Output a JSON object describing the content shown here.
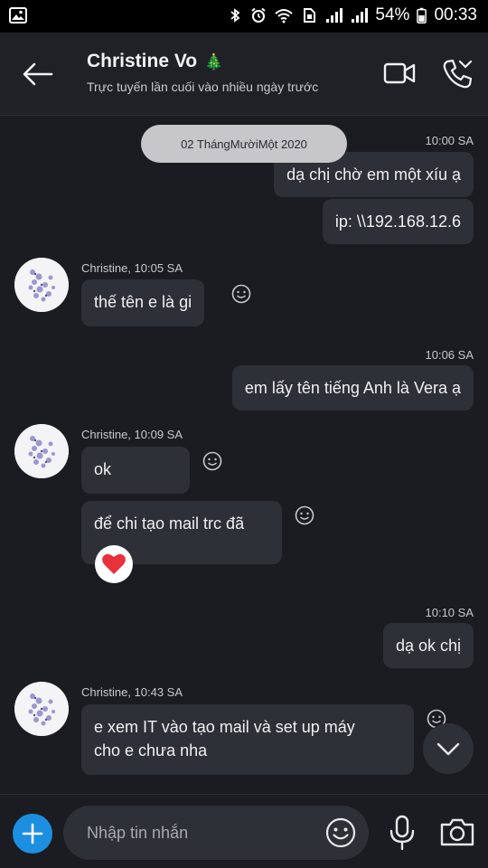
{
  "status_bar": {
    "battery": "54%",
    "time": "00:33",
    "icons": [
      "gallery-icon",
      "bluetooth-icon",
      "alarm-icon",
      "wifi-icon",
      "sim-icon",
      "signal-icon",
      "signal-icon",
      "battery-icon"
    ]
  },
  "header": {
    "contact_name": "Christine Vo",
    "name_emoji": "🎄",
    "status": "Trực tuyến lần cuối vào nhiều ngày trước"
  },
  "chat": {
    "date_pill": "02 ThángMườiMột 2020",
    "items": [
      {
        "time": "10:00 SA"
      },
      {
        "text": "dạ chị chờ em một xíu ạ"
      },
      {
        "text": "ip: \\\\192.168.12.6"
      },
      {
        "sender": "Christine, 10:05 SA"
      },
      {
        "text": "thế tên e là gi"
      },
      {
        "time": "10:06 SA"
      },
      {
        "text": "em lấy tên tiếng Anh là Vera ạ"
      },
      {
        "sender": "Christine, 10:09 SA"
      },
      {
        "text": "ok"
      },
      {
        "text": "để chi tạo mail trc đã",
        "reaction": "❤"
      },
      {
        "time": "10:10 SA"
      },
      {
        "text": "dạ ok chị"
      },
      {
        "sender": "Christine, 10:43 SA"
      },
      {
        "text_line1": "e xem IT vào tạo mail và set up máy",
        "text_line2": "cho e chưa nha"
      }
    ]
  },
  "composer": {
    "placeholder": "Nhập tin nhắn"
  },
  "colors": {
    "background": "#1b1c21",
    "bubble": "#2e3037",
    "accent_blue": "#1d8fe0",
    "date_pill": "#c7c7ca",
    "heart": "#e8313a"
  }
}
